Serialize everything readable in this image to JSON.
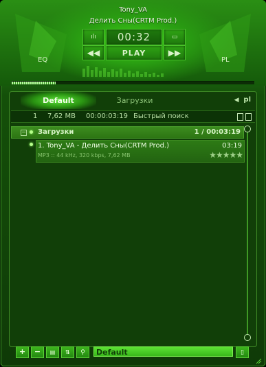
{
  "window": {
    "artist": "Tony_VA",
    "track": "Делить Сны(CRTM Prod.)"
  },
  "controls": {
    "time": "00:32",
    "play_label": "PLAY",
    "eq_label": "EQ",
    "pl_label": "PL",
    "seek_progress_fraction": 0.18
  },
  "tabs": [
    {
      "label": "Default",
      "active": true
    },
    {
      "label": "Загрузки",
      "active": false
    }
  ],
  "tab_nav": {
    "pl": "pl"
  },
  "info_bar": {
    "count": "1",
    "size": "7,62 MB",
    "duration": "00:00:03:19",
    "search_label": "Быстрый поиск"
  },
  "group": {
    "name": "Загрузки",
    "summary": "1 / 00:03:19",
    "collapse_symbol": "−"
  },
  "tracks": [
    {
      "title": "1. Tony_VA - Делить Сны(CRTM Prod.)",
      "time": "03:19",
      "meta": "MP3 :: 44 kHz, 320 kbps, 7,62 MB",
      "rating": "★★★★★"
    }
  ],
  "bottom": {
    "playlist_name": "Default",
    "buttons": [
      "+",
      "−",
      "",
      "",
      ""
    ]
  },
  "colors": {
    "accent": "#3fd11a",
    "panel": "#113f08",
    "text": "#f0ffe6"
  }
}
